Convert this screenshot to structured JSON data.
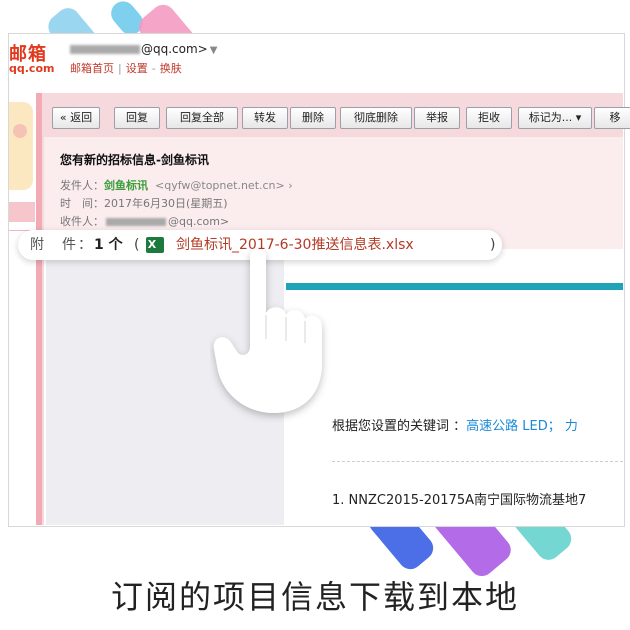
{
  "mailbox": {
    "logo_text": "邮箱",
    "logo_sub": "qq.com",
    "account": "@qq.com>",
    "links": [
      "邮箱首页",
      "设置",
      "换肤"
    ]
  },
  "toolbar": {
    "buttons": [
      "« 返回",
      "回复",
      "回复全部",
      "转发",
      "删除",
      "彻底删除",
      "举报",
      "拒收",
      "标记为... ▾",
      "移"
    ]
  },
  "email": {
    "subject": "您有新的招标信息-剑鱼标讯",
    "sender_label": "发件人：",
    "sender_name": "剑鱼标讯",
    "sender_addr": "<qyfw@topnet.net.cn>",
    "time_label": "时　间：",
    "time_value": "2017年6月30日(星期五)",
    "recipient_label": "收件人：",
    "recipient_addr": "@qq.com>"
  },
  "attachment": {
    "label": "附　件：",
    "count": "1 个",
    "open_paren": "(",
    "filename": "剑鱼标讯_2017-6-30推送信息表.xlsx",
    "close_paren": ")"
  },
  "body": {
    "keyword_label": "根据您设置的关键词 ：",
    "keyword_values": "高速公路 LED； 力",
    "item1": "1. NNZC2015-20175A南宁国际物流基地7"
  },
  "caption": "订阅的项目信息下载到本地"
}
